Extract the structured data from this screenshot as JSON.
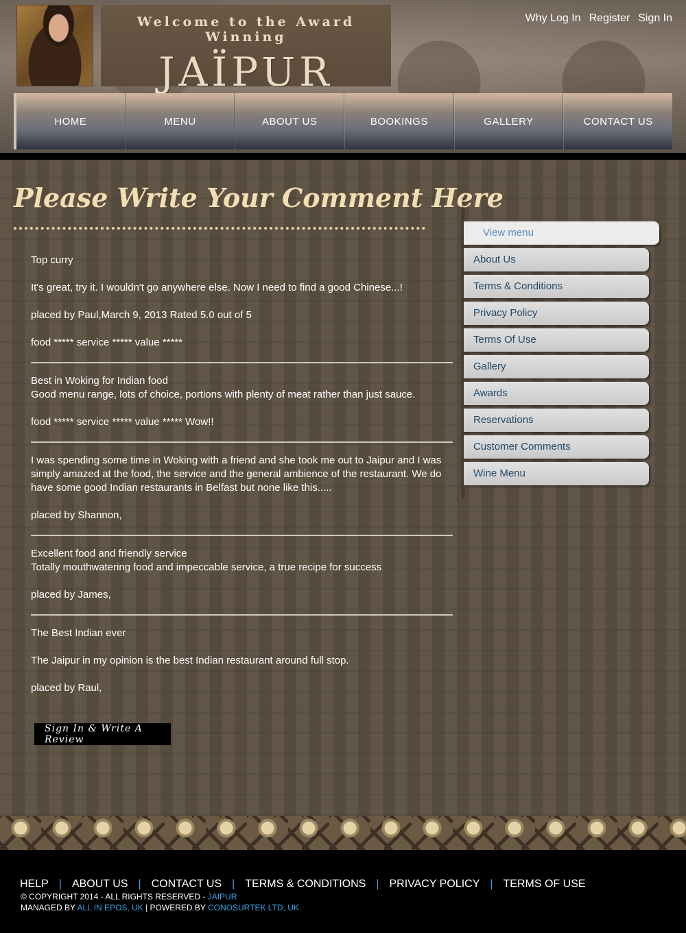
{
  "header": {
    "logo_welcome": "Welcome to the Award Winning",
    "logo_name": "JAÏPUR",
    "top_links": [
      "Why Log In",
      "Register",
      "Sign In"
    ]
  },
  "nav": [
    "HOME",
    "MENU",
    "ABOUT US",
    "BOOKINGS",
    "GALLERY",
    "CONTACT US"
  ],
  "main": {
    "title": "Please Write Your Comment Here",
    "comments": [
      {
        "lines": [
          "Top curry",
          "",
          "It's great, try it. I wouldn't go anywhere else. Now I need to find a good Chinese...!",
          "",
          "placed by Paul,March 9, 2013 Rated 5.0 out of 5",
          "",
          "food ***** service ***** value *****"
        ]
      },
      {
        "lines": [
          "Best in Woking for Indian food",
          "Good menu range, lots of choice, portions with plenty of meat rather than just sauce.",
          "",
          "food ***** service ***** value ***** Wow!!"
        ]
      },
      {
        "lines": [
          "I was spending some time in Woking with a friend and she took me out to Jaipur and I was simply amazed at the food, the service and the general ambience of the restaurant. We do have some good Indian restaurants in Belfast but none like this.....",
          "",
          "placed by Shannon,"
        ]
      },
      {
        "lines": [
          "Excellent food and friendly service",
          "Totally mouthwatering food and impeccable service, a true recipe for success",
          "",
          "placed by James,"
        ]
      },
      {
        "lines": [
          "The Best Indian ever",
          "",
          "The Jaipur in my opinion is the best Indian restaurant around full stop.",
          "",
          "placed by Raul,"
        ]
      }
    ],
    "review_button": "Sign In & Write A Review"
  },
  "sidebar": {
    "items": [
      "View menu",
      "About Us",
      "Terms & Conditions",
      "Privacy Policy",
      "Terms Of Use",
      "Gallery",
      "Awards",
      "Reservations",
      "Customer Comments",
      "Wine Menu"
    ]
  },
  "footer": {
    "links": [
      "HELP",
      "ABOUT US",
      "CONTACT US",
      "TERMS & CONDITIONS",
      "PRIVACY POLICY",
      "TERMS OF USE"
    ],
    "copyright_text": "© COPYRIGHT 2014 - ALL RIGHTS RESERVED - ",
    "copyright_link": "JAIPUR",
    "managed_text": "MANAGED BY ",
    "managed_link": "ALL IN EPOS, UK",
    "powered_text": " | POWERED BY ",
    "powered_link": "CONOSURTEK LTD, UK."
  },
  "colors": {
    "accent_link": "#3aa3e3",
    "title": "#f2deb3",
    "sidebar_text": "#234a6a"
  }
}
